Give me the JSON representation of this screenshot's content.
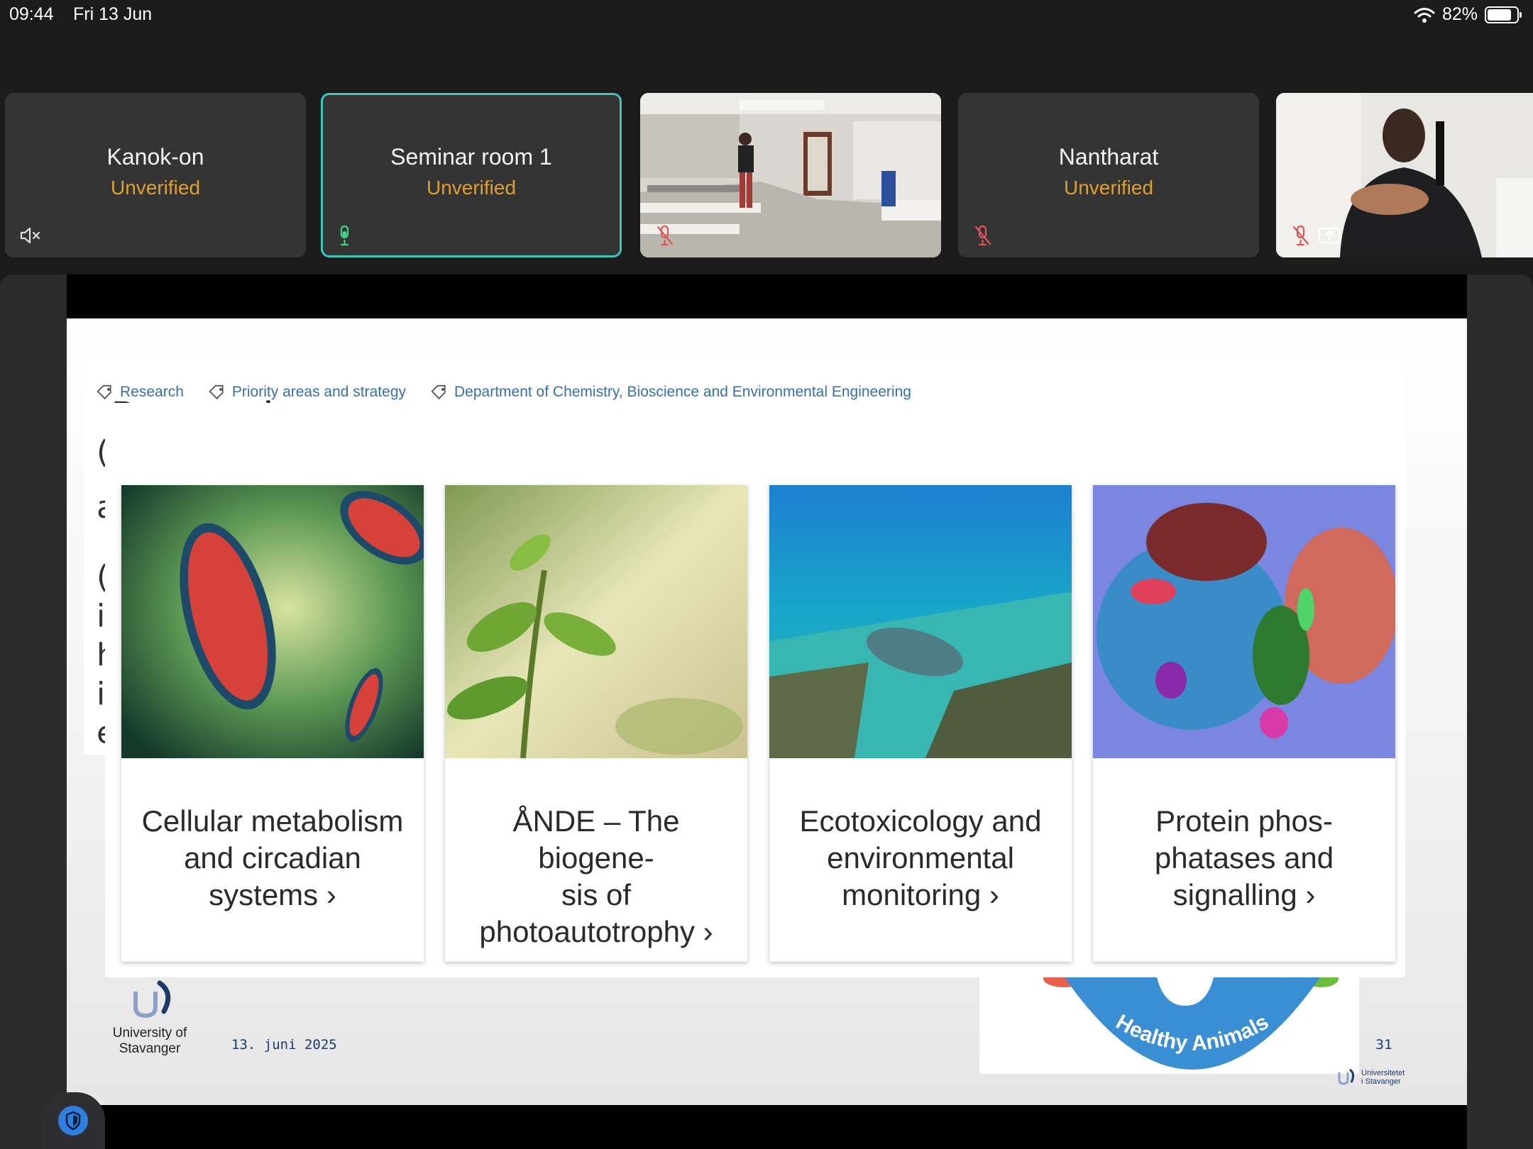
{
  "status_bar": {
    "time": "09:44",
    "date": "Fri 13 Jun",
    "battery": "82%",
    "battery_level": 0.82
  },
  "participants": [
    {
      "name": "Kanok-on",
      "status": "Unverified",
      "audio": "speaker-muted"
    },
    {
      "name": "Seminar room 1",
      "status": "Unverified",
      "audio": "mic-active",
      "active": true
    },
    {
      "name": "",
      "status": "",
      "audio": "mic-muted",
      "video": "classroom"
    },
    {
      "name": "Nantharat",
      "status": "Unverified",
      "audio": "mic-muted"
    },
    {
      "name": "",
      "status": "",
      "audio": "mic-muted",
      "video": "speaker",
      "screen_share": true
    }
  ],
  "slide": {
    "tags": [
      "Research",
      "Priority areas and strategy",
      "Department of Chemistry, Bioscience and Environmental Engineering"
    ],
    "heading": "Research areas",
    "fragments": [
      "(",
      "a",
      "(",
      "i",
      "h",
      "i",
      "e"
    ],
    "cards": [
      {
        "title": "Cellular metabolism\nand circadian\nsystems ›"
      },
      {
        "title": "ÅNDE – The biogene-\nsis of\nphotoautotrophy ›"
      },
      {
        "title": "Ecotoxicology and\nenvironmental\nmonitoring ›"
      },
      {
        "title": "Protein phos-\nphatases and\nsignalling ›"
      }
    ],
    "footer": {
      "logo_text_1": "University of",
      "logo_text_2": "Stavanger",
      "date": "13. juni 2025",
      "page": "31",
      "badge": "Healthy Animals",
      "small_logo_1": "Universitetet",
      "small_logo_2": "i Stavanger"
    }
  },
  "colors": {
    "accent": "#3cc8b8",
    "unverified": "#e0a030",
    "muted": "#e05555",
    "link": "#3a6fa8",
    "uis_blue": "#1d3a6a"
  }
}
